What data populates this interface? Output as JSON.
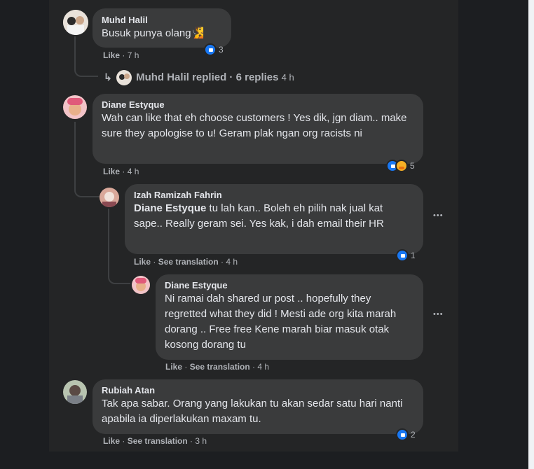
{
  "colors": {
    "page_bg": "#1c1e21",
    "panel_bg": "#242526",
    "bubble_bg": "#3a3b3c",
    "text": "#e4e6eb",
    "meta": "#b0b3b8",
    "like": "#1877f2"
  },
  "comments": [
    {
      "author": "Muhd Halil",
      "text": "Busuk punya olang🧏",
      "actions": [
        "Like"
      ],
      "time": "7 h",
      "reactions": [
        "like-icon"
      ],
      "reaction_count": "3"
    },
    {
      "replies_link": {
        "author": "Muhd Halil replied",
        "count": "6 replies",
        "time": "4 h"
      }
    },
    {
      "author": "Diane Estyque",
      "text": "Wah can like that eh choose customers ! Yes dik, jgn diam.. make sure they apologise to u! Geram plak ngan org racists ni",
      "actions": [
        "Like"
      ],
      "time": "4 h",
      "reactions": [
        "like-icon",
        "care-icon"
      ],
      "reaction_count": "5"
    },
    {
      "author": "Izah Ramizah Fahrin",
      "mention": "Diane Estyque",
      "text": "tu lah kan.. Boleh eh pilih nak jual kat sape.. Really geram sei. Yes kak, i dah email their HR",
      "actions": [
        "Like",
        "See translation"
      ],
      "time": "4 h",
      "reactions": [
        "like-icon"
      ],
      "reaction_count": "1"
    },
    {
      "author": "Diane Estyque",
      "text": "Ni ramai dah shared ur post .. hopefully they regretted what they did ! Mesti ade org kita marah dorang .. Free free Kene marah biar masuk otak kosong dorang tu",
      "actions": [
        "Like",
        "See translation"
      ],
      "time": "4 h"
    },
    {
      "author": "Rubiah Atan",
      "text": "Tak apa sabar. Orang yang lakukan tu akan sedar satu hari nanti apabila ia diperlakukan maxam tu.",
      "actions": [
        "Like",
        "See translation"
      ],
      "time": "3 h",
      "reactions": [
        "like-icon"
      ],
      "reaction_count": "2"
    }
  ],
  "more_options_label": "•••"
}
